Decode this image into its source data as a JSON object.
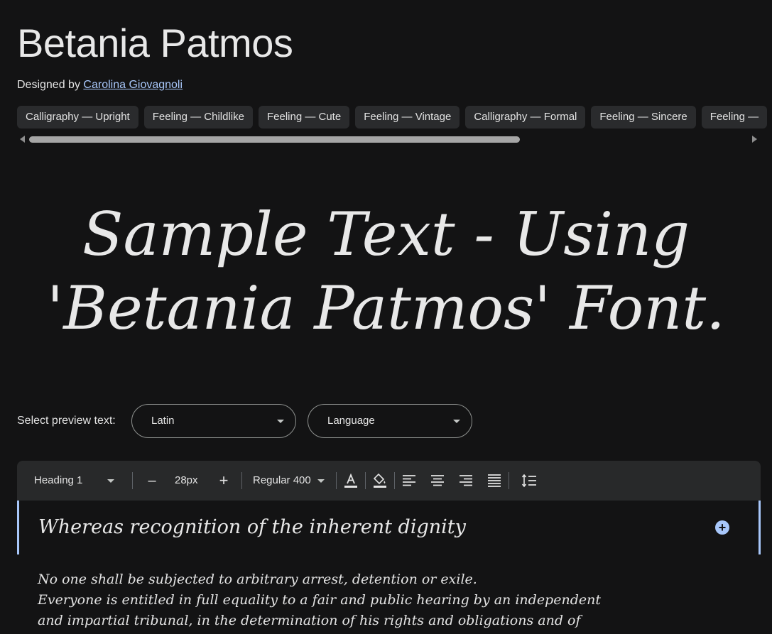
{
  "font": {
    "title": "Betania Patmos",
    "designed_by_label": "Designed by",
    "designer": "Carolina Giovagnoli"
  },
  "tags": [
    "Calligraphy — Upright",
    "Feeling — Childlike",
    "Feeling — Cute",
    "Feeling — Vintage",
    "Calligraphy — Formal",
    "Feeling — Sincere",
    "Feeling —"
  ],
  "sample_text": {
    "line1": "Sample Text - Using",
    "line2": "'Betania Patmos' Font."
  },
  "preview": {
    "label": "Select preview text:",
    "script_value": "Latin",
    "language_value": "Language"
  },
  "toolbar": {
    "style_value": "Heading 1",
    "size_value": "28px",
    "weight_value": "Regular 400",
    "minus_label": "–",
    "plus_label": "+"
  },
  "editor": {
    "heading": "Whereas recognition of the inherent dignity",
    "paragraph_lines": [
      "No one shall be subjected to arbitrary arrest, detention or exile.",
      "Everyone is entitled in full equality to a fair and public hearing by an independent",
      "and impartial tribunal, in the determination of his rights and obligations and of"
    ]
  },
  "colors": {
    "background": "#131314",
    "accent": "#a8c7fa",
    "chip": "#2a2b2d",
    "toolbar": "#28292a"
  }
}
